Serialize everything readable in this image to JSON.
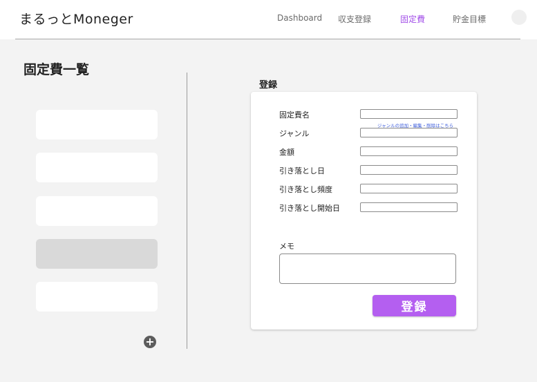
{
  "header": {
    "app_title": "まるっとMoneger",
    "nav": [
      {
        "label": "Dashboard"
      },
      {
        "label": "収支登録"
      },
      {
        "label": "固定費"
      },
      {
        "label": "貯金目標"
      }
    ],
    "active_nav": "固定費"
  },
  "list": {
    "title": "固定費一覧",
    "item_count": 5,
    "selected_index": 3
  },
  "form": {
    "heading": "登録",
    "fields": [
      {
        "label": "固定費名",
        "value": ""
      },
      {
        "label": "ジャンル",
        "value": ""
      },
      {
        "label": "金額",
        "value": ""
      },
      {
        "label": "引き落とし日",
        "value": ""
      },
      {
        "label": "引き落とし頻度",
        "value": ""
      },
      {
        "label": "引き落とし開始日",
        "value": ""
      }
    ],
    "genre_link": "ジャンルの追加・編集・削除はこちら",
    "memo_label": "メモ",
    "memo_value": "",
    "submit_label": "登録"
  },
  "colors": {
    "accent": "#b45ff0",
    "active_nav": "#a24ee8",
    "link": "#3b5bdb",
    "background": "#f3f3f3"
  },
  "icons": {
    "add": "plus-circle-icon",
    "avatar": "avatar"
  }
}
